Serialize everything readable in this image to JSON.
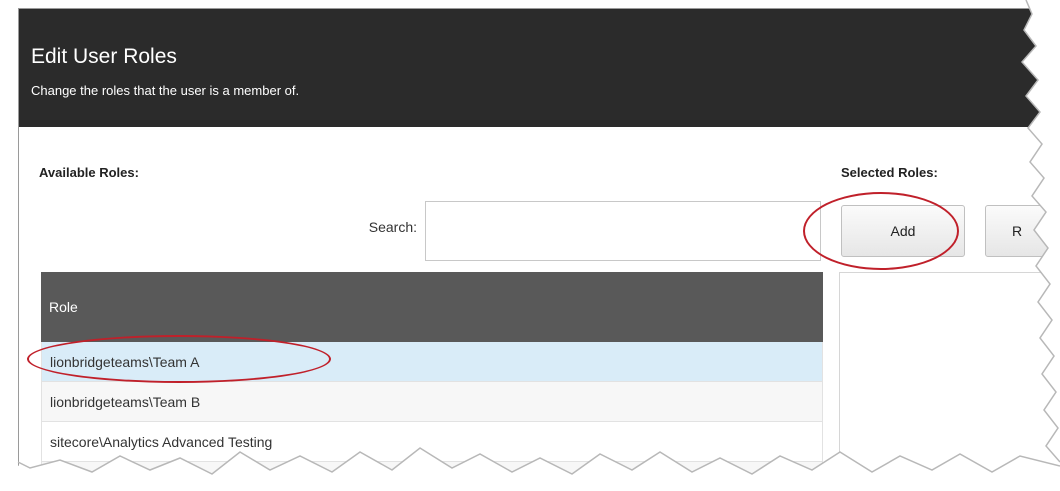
{
  "dialog": {
    "title": "Edit User Roles",
    "subtitle": "Change the roles that the user is a member of."
  },
  "available": {
    "label": "Available Roles:",
    "search_label": "Search:",
    "search_value": "",
    "column_header": "Role",
    "rows": [
      "lionbridgeteams\\Team A",
      "lionbridgeteams\\Team B",
      "sitecore\\Analytics Advanced Testing"
    ],
    "selected_row": "lionbridgeteams\\Team A"
  },
  "selected": {
    "label": "Selected Roles:",
    "add_button": "Add",
    "remove_button_partial": "R"
  },
  "colors": {
    "header_bg": "#2b2b2b",
    "table_header_bg": "#595959",
    "selected_row_bg": "#d9ecf8",
    "highlight_annotation": "#c0202a"
  }
}
